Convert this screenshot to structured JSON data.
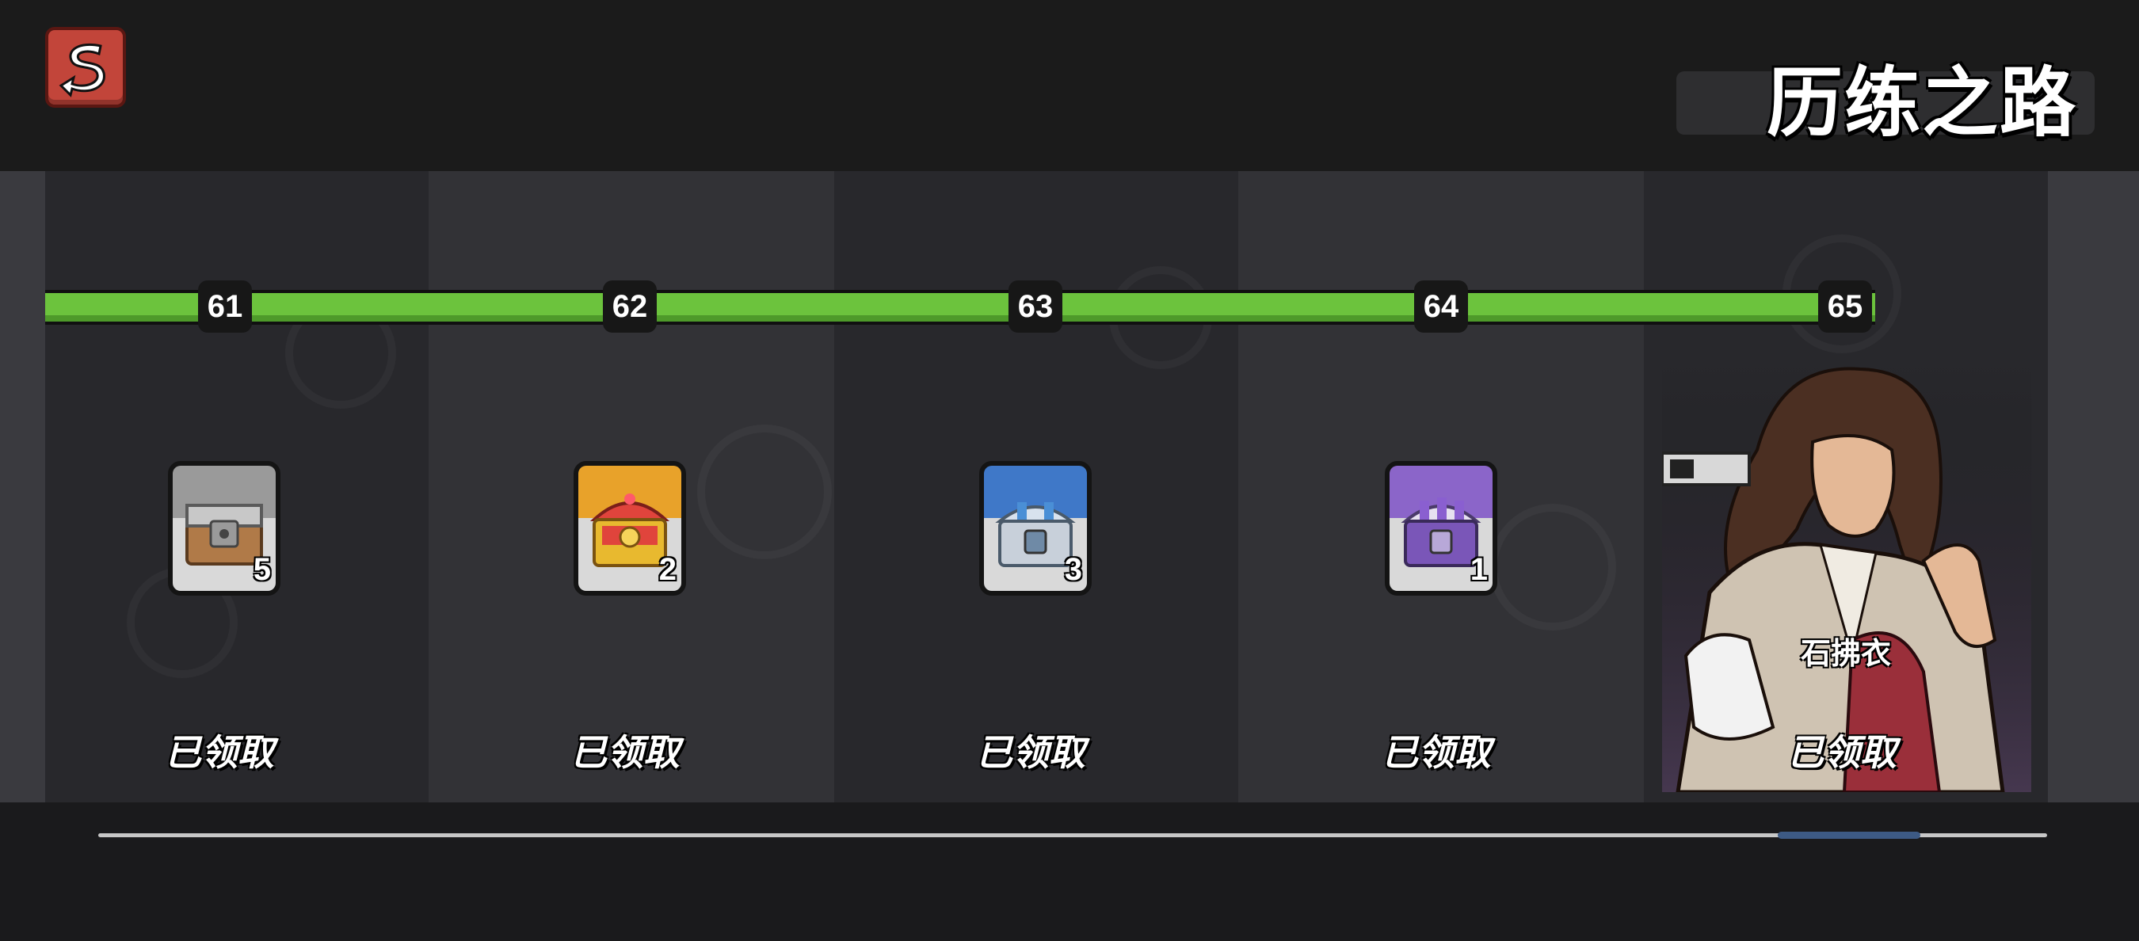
{
  "header": {
    "title": "历练之路",
    "back_icon": "back-arrow-icon"
  },
  "progress": {
    "levels": [
      "61",
      "62",
      "63",
      "64",
      "65"
    ],
    "fill_fraction": 1.0,
    "bar_color": "#6cc33d"
  },
  "rewards": [
    {
      "level": "61",
      "icon": "wooden-chest-icon",
      "count": "5",
      "status": "已领取",
      "frame_color": "#9a9a9a"
    },
    {
      "level": "62",
      "icon": "gold-chest-icon",
      "count": "2",
      "status": "已领取",
      "frame_color": "#e8a22a"
    },
    {
      "level": "63",
      "icon": "silver-chest-icon",
      "count": "3",
      "status": "已领取",
      "frame_color": "#3f78c8"
    },
    {
      "level": "64",
      "icon": "purple-chest-icon",
      "count": "1",
      "status": "已领取",
      "frame_color": "#8b65c9"
    },
    {
      "level": "65",
      "icon": "hero-portrait",
      "hero_name": "石拂衣",
      "status": "已领取"
    }
  ],
  "scrollbar": {
    "position_fraction": 0.93
  }
}
